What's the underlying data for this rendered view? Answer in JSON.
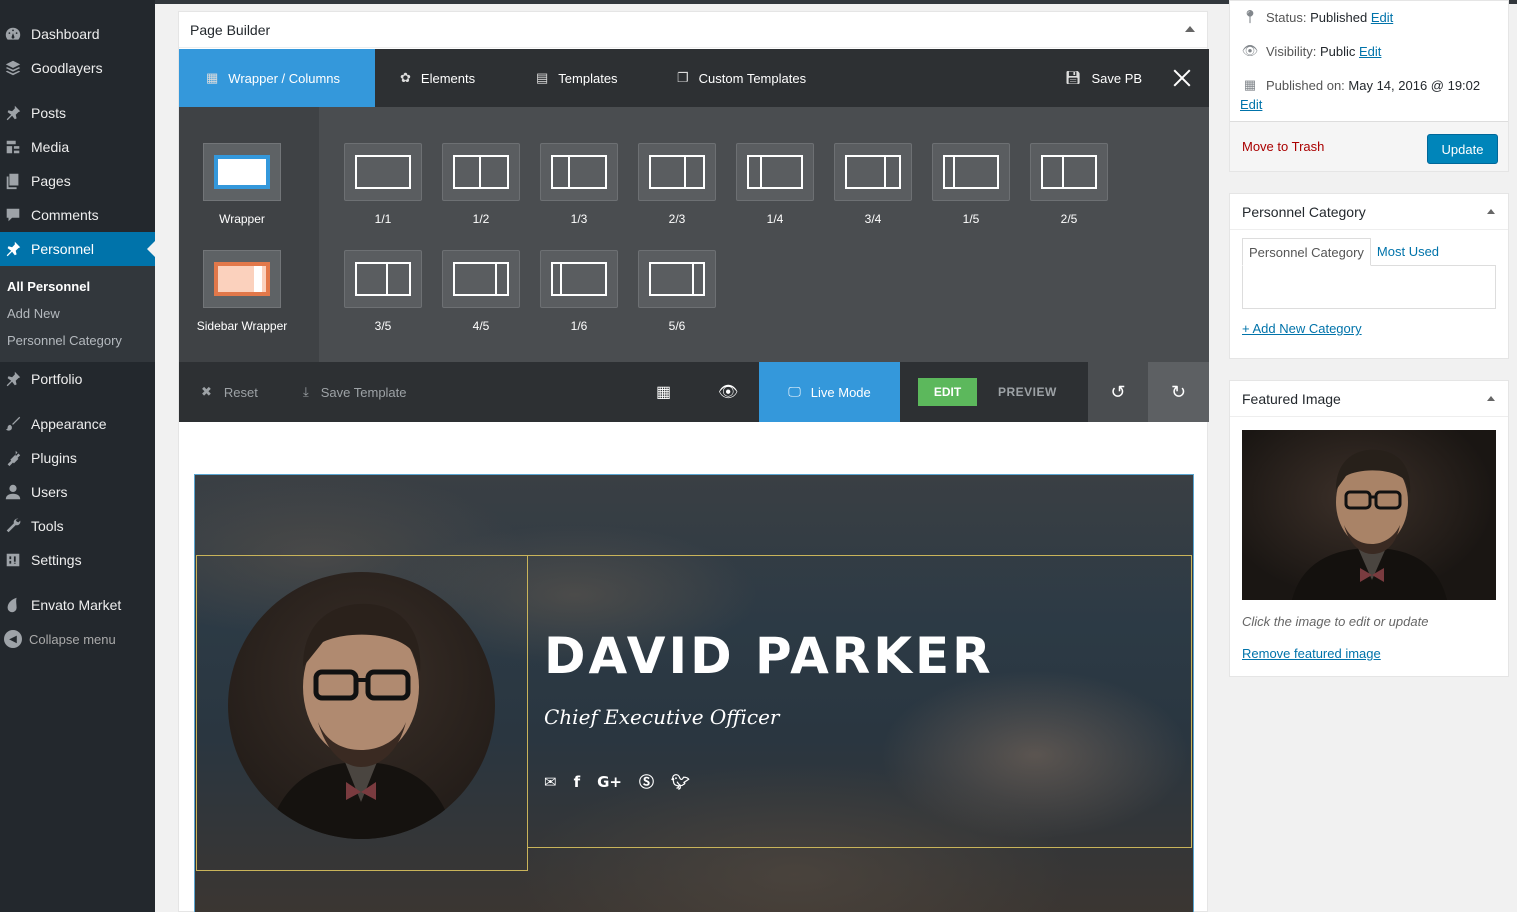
{
  "sidebar": {
    "items": [
      {
        "label": "Dashboard",
        "icon": "dashboard-icon"
      },
      {
        "label": "Goodlayers",
        "icon": "layers-icon"
      },
      {
        "label": "Posts",
        "icon": "pin-icon"
      },
      {
        "label": "Media",
        "icon": "media-icon"
      },
      {
        "label": "Pages",
        "icon": "pages-icon"
      },
      {
        "label": "Comments",
        "icon": "comments-icon"
      },
      {
        "label": "Personnel",
        "icon": "pin-icon"
      },
      {
        "label": "Portfolio",
        "icon": "pin-icon"
      },
      {
        "label": "Appearance",
        "icon": "brush-icon"
      },
      {
        "label": "Plugins",
        "icon": "plugin-icon"
      },
      {
        "label": "Users",
        "icon": "users-icon"
      },
      {
        "label": "Tools",
        "icon": "wrench-icon"
      },
      {
        "label": "Settings",
        "icon": "settings-icon"
      },
      {
        "label": "Envato Market",
        "icon": "leaf-icon"
      }
    ],
    "submenu": [
      "All Personnel",
      "Add New",
      "Personnel Category"
    ],
    "collapse": "Collapse menu"
  },
  "page_builder": {
    "title": "Page Builder",
    "tabs": [
      "Wrapper / Columns",
      "Elements",
      "Templates",
      "Custom Templates"
    ],
    "save": "Save PB",
    "wrappers": [
      "Wrapper",
      "Sidebar Wrapper"
    ],
    "columns": [
      "1/1",
      "1/2",
      "1/3",
      "2/3",
      "1/4",
      "3/4",
      "1/5",
      "2/5",
      "3/5",
      "4/5",
      "1/6",
      "5/6"
    ],
    "bottom": {
      "reset": "Reset",
      "save_template": "Save Template",
      "live_mode": "Live Mode",
      "edit": "EDIT",
      "preview": "PREVIEW"
    }
  },
  "hero": {
    "name": "DAVID PARKER",
    "title": "Chief Executive Officer",
    "social": [
      "email-icon",
      "facebook-icon",
      "google-plus-icon",
      "skype-icon",
      "twitter-icon"
    ]
  },
  "publish": {
    "status_label": "Status:",
    "status_value": "Published",
    "visibility_label": "Visibility:",
    "visibility_value": "Public",
    "published_label": "Published on:",
    "published_value": "May 14, 2016 @ 19:02",
    "edit": "Edit",
    "trash": "Move to Trash",
    "update": "Update"
  },
  "category": {
    "title": "Personnel Category",
    "tab_all": "Personnel Category",
    "tab_used": "Most Used",
    "add_new": "+ Add New Category"
  },
  "featured": {
    "title": "Featured Image",
    "hint": "Click the image to edit or update",
    "remove": "Remove featured image"
  },
  "colors": {
    "accent": "#3498db",
    "wp_blue": "#0073aa",
    "edit_green": "#5cb85c"
  }
}
